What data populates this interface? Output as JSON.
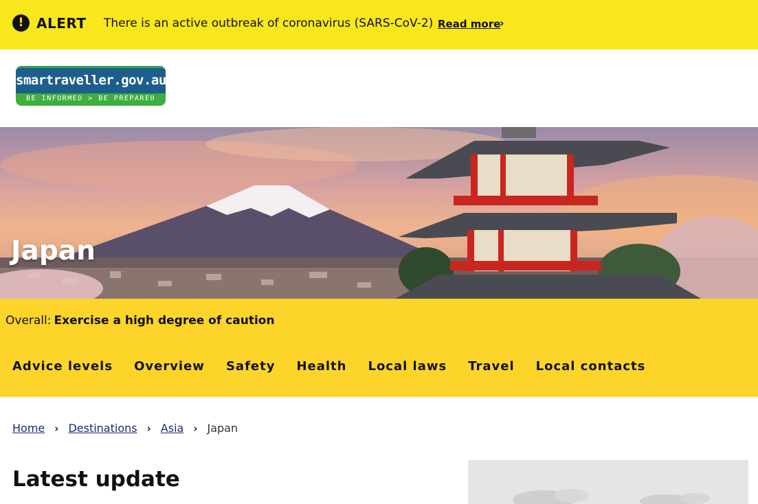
{
  "alert": {
    "icon": "exclamation-icon",
    "title": "ALERT",
    "message": "There is an active outbreak of coronavirus (SARS-CoV-2)",
    "link_label": "Read more",
    "link_icon": "chevron-right-icon",
    "color": "#f8e71c"
  },
  "logo": {
    "name": "smartraveller.gov.au",
    "tagline": "BE INFORMED  >  BE PREPARED"
  },
  "hero": {
    "title": "Japan"
  },
  "advice": {
    "label": "Overall:",
    "level": "Exercise a high degree of caution",
    "color": "#fdd42a"
  },
  "nav": {
    "items": [
      "Advice levels",
      "Overview",
      "Safety",
      "Health",
      "Local laws",
      "Travel",
      "Local contacts"
    ]
  },
  "breadcrumb": {
    "items": [
      "Home",
      "Destinations",
      "Asia"
    ],
    "current": "Japan"
  },
  "main": {
    "heading": "Latest update"
  }
}
